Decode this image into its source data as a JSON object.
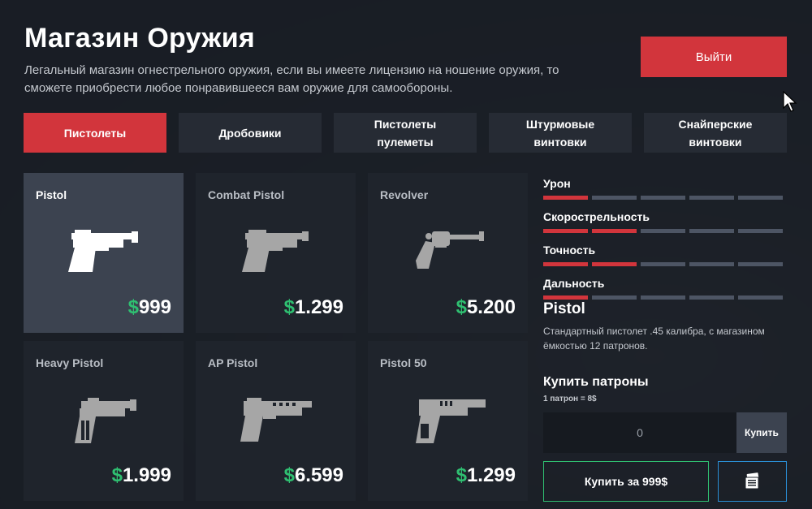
{
  "header": {
    "title": "Магазин Оружия",
    "subtitle": "Легальный магазин огнестрельного оружия, если вы имеете лицензию на ношение оружия, то сможете приобрести любое понравившееся вам оружие для самообороны.",
    "exit_label": "Выйти"
  },
  "tabs": [
    {
      "label": "Пистолеты",
      "active": true
    },
    {
      "label": "Дробовики",
      "active": false
    },
    {
      "label": "Пистолеты\nпулеметы",
      "active": false
    },
    {
      "label": "Штурмовые\nвинтовки",
      "active": false
    },
    {
      "label": "Снайперские\nвинтовки",
      "active": false
    }
  ],
  "weapons": [
    {
      "name": "Pistol",
      "currency": "$",
      "price": "999",
      "icon": "pistol-icon",
      "selected": true
    },
    {
      "name": "Combat Pistol",
      "currency": "$",
      "price": "1.299",
      "icon": "combat-pistol-icon",
      "selected": false
    },
    {
      "name": "Revolver",
      "currency": "$",
      "price": "5.200",
      "icon": "revolver-icon",
      "selected": false
    },
    {
      "name": "Heavy Pistol",
      "currency": "$",
      "price": "1.999",
      "icon": "heavy-pistol-icon",
      "selected": false
    },
    {
      "name": "AP Pistol",
      "currency": "$",
      "price": "6.599",
      "icon": "ap-pistol-icon",
      "selected": false
    },
    {
      "name": "Pistol 50",
      "currency": "$",
      "price": "1.299",
      "icon": "pistol-50-icon",
      "selected": false
    }
  ],
  "stats": [
    {
      "label": "Урон",
      "level": 1,
      "max": 5
    },
    {
      "label": "Скорострельность",
      "level": 2,
      "max": 5
    },
    {
      "label": "Точность",
      "level": 2,
      "max": 5
    },
    {
      "label": "Дальность",
      "level": 1,
      "max": 5
    }
  ],
  "details": {
    "name": "Pistol",
    "description": "Стандартный пистолет .45 калибра, с магазином ёмкостью 12 патронов."
  },
  "ammo": {
    "title": "Купить патроны",
    "note": "1 патрон = 8$",
    "value": "0",
    "buy_label": "Купить"
  },
  "purchase": {
    "buy_label": "Купить за 999$",
    "cash_icon": "cash-icon"
  },
  "colors": {
    "accent_red": "#d2353c",
    "price_green": "#2fbf71",
    "cash_blue": "#2a8fd6"
  }
}
